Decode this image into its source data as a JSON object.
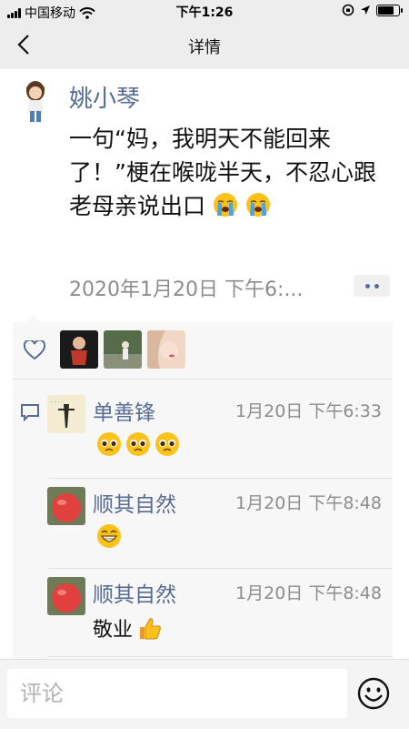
{
  "status_bar": {
    "carrier": "中国移动",
    "time": "下午1:26",
    "icons": [
      "signal-icon",
      "wifi-icon",
      "orientation-lock-icon",
      "location-icon",
      "battery-icon"
    ]
  },
  "nav": {
    "title": "详情",
    "back_icon": "chevron-left-icon"
  },
  "post": {
    "author": "姚小琴",
    "text": "一句“妈，我明天不能回来了！”梗在喉咙半天，不忍心跟老母亲说出口",
    "emojis": [
      "loudly-crying-face",
      "loudly-crying-face"
    ],
    "timestamp": "2020年1月20日 下午6:...",
    "more_icon": "more-dots-icon"
  },
  "likes": {
    "icon": "heart-icon",
    "avatars": [
      "avatar-child",
      "avatar-outdoor",
      "avatar-girl"
    ]
  },
  "comments": [
    {
      "author": "单善锋",
      "time": "1月20日 下午6:33",
      "text": "",
      "emojis": [
        "pleading-face",
        "pleading-face",
        "pleading-face"
      ]
    },
    {
      "author": "顺其自然",
      "time": "1月20日 下午8:48",
      "text": "",
      "emojis": [
        "grinning-face"
      ]
    },
    {
      "author": "顺其自然",
      "time": "1月20日 下午8:48",
      "text": "敬业",
      "emojis": [
        "thumbs-up"
      ]
    }
  ],
  "comment_box": {
    "placeholder": "评论",
    "emoji_icon": "smiley-icon"
  },
  "colors": {
    "name_blue": "#576b95",
    "bar_bg": "#ededed",
    "panel_bg": "#f7f7f7",
    "time_gray": "#8c8c8c"
  }
}
